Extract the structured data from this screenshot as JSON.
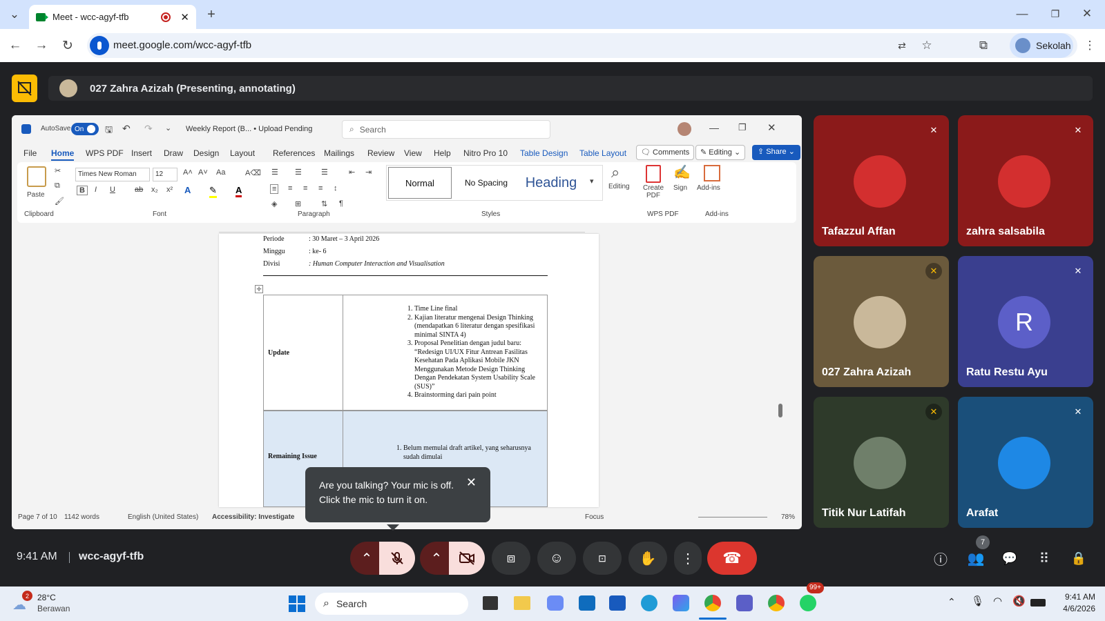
{
  "browser": {
    "tab_title": "Meet - wcc-agyf-tfb",
    "url": "meet.google.com/wcc-agyf-tfb",
    "profile_label": "Sekolah"
  },
  "meet": {
    "presenter_label": "027 Zahra Azizah (Presenting, annotating)",
    "time": "9:41 AM",
    "meeting_code": "wcc-agyf-tfb",
    "participants_count": "7",
    "tooltip_text": "Are you talking? Your mic is off. Click the mic to turn it on.",
    "participants": [
      {
        "name": "Tafazzul Affan",
        "bg": "#8b1a1a",
        "avatar_bg": "#d32f2f",
        "initial": ""
      },
      {
        "name": "zahra salsabila",
        "bg": "#8b1a1a",
        "avatar_bg": "#d32f2f",
        "initial": ""
      },
      {
        "name": "027 Zahra Azizah",
        "bg": "#6b5a3c",
        "avatar_bg": "#c9b89a",
        "initial": ""
      },
      {
        "name": "Ratu Restu Ayu",
        "bg": "#3a3f8f",
        "avatar_bg": "#5c5fc8",
        "initial": "R"
      },
      {
        "name": "Titik Nur Latifah",
        "bg": "#2e3a2a",
        "avatar_bg": "#6f7f6a",
        "initial": ""
      },
      {
        "name": "Arafat",
        "bg": "#1a4f7a",
        "avatar_bg": "#1e88e5",
        "initial": ""
      }
    ]
  },
  "word": {
    "autosave": "AutoSave",
    "autosave_state": "On",
    "doc_title": "Weekly Report (B... • Upload Pending",
    "search_placeholder": "Search",
    "tabs": [
      "File",
      "Home",
      "WPS PDF",
      "Insert",
      "Draw",
      "Design",
      "Layout",
      "References",
      "Mailings",
      "Review",
      "View",
      "Help",
      "Nitro Pro 10",
      "Table Design",
      "Table Layout"
    ],
    "comments": "Comments",
    "editing": "Editing",
    "share": "Share",
    "font_name": "Times New Roman",
    "font_size": "12",
    "styles": [
      "Normal",
      "No Spacing",
      "Heading"
    ],
    "groups": [
      "Clipboard",
      "Font",
      "Paragraph",
      "Styles",
      "WPS PDF",
      "Add-ins"
    ],
    "paste": "Paste",
    "editing_btn": "Editing",
    "create_pdf": "Create PDF",
    "sign": "Sign",
    "addins": "Add-ins",
    "doc": {
      "periode": "Periode",
      "periode_val": ": 30 Maret – 3 April 2026",
      "minggu": "Minggu",
      "minggu_val": ": ke- 6",
      "divisi": "Divisi",
      "divisi_val": ": Human Computer Interaction and Visualisation",
      "update_label": "Update",
      "update_items": [
        "Time Line final",
        "Kajian literatur mengenai Design Thinking (mendapatkan 6 literatur dengan spesifikasi minimal SINTA 4)",
        "Proposal Penelitian dengan judul baru: “Redesign UI/UX Fitur Antrean Fasilitas Kesehatan Pada Aplikasi Mobile JKN Menggunakan Metode Design Thinking Dengan Pendekatan System Usability Scale (SUS)”",
        "Brainstorming dari pain point"
      ],
      "remaining_label": "Remaining Issue",
      "remaining_items": [
        "Belum memulai draft artikel, yang seharusnya sudah dimulai"
      ]
    },
    "status": {
      "page": "Page 7 of 10",
      "words": "1142 words",
      "language": "English (United States)",
      "accessibility": "Accessibility: Investigate",
      "focus": "Focus",
      "zoom": "78%"
    }
  },
  "taskbar": {
    "weather_temp": "28°C",
    "weather_desc": "Berawan",
    "weather_badge": "2",
    "search": "Search",
    "whatsapp_badge": "99+",
    "time": "9:41 AM",
    "date": "4/6/2026"
  }
}
